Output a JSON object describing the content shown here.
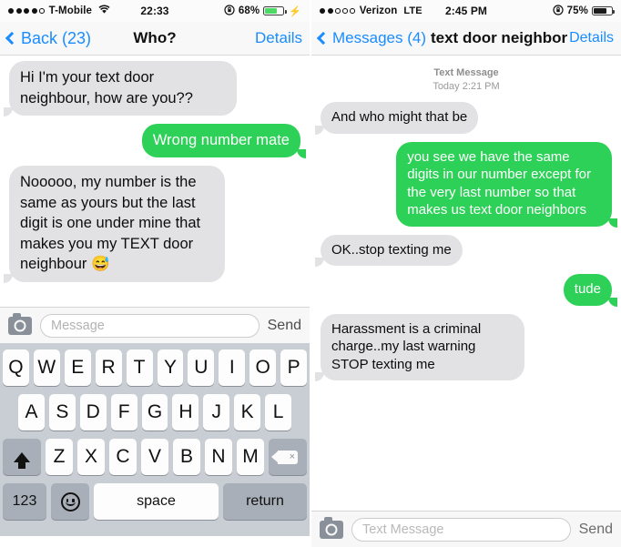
{
  "left_phone": {
    "status_bar": {
      "signal_dots_filled": 4,
      "signal_dots_total": 5,
      "carrier": "T-Mobile",
      "wifi_icon": "wifi-icon",
      "time": "22:33",
      "lock_rotation_icon": "rotation-lock-icon",
      "battery_percent": "68%",
      "battery_level": 68,
      "battery_color": "#4cd964",
      "charging_icon": "lightning-bolt-icon"
    },
    "nav_bar": {
      "back_label": "Back (23)",
      "back_icon": "chevron-left-icon",
      "title": "Who?",
      "details_label": "Details"
    },
    "messages": [
      {
        "side": "in",
        "text": "Hi I'm your text door neighbour, how are you??"
      },
      {
        "side": "out",
        "text": "Wrong number mate"
      },
      {
        "side": "in",
        "text": "Nooooo, my number is the same as yours but the last digit is one under mine that makes you my TEXT door neighbour 😅"
      }
    ],
    "composer": {
      "camera_icon": "camera-icon",
      "input_value": "",
      "input_placeholder": "Message",
      "send_label": "Send"
    },
    "keyboard": {
      "row1": [
        "Q",
        "W",
        "E",
        "R",
        "T",
        "Y",
        "U",
        "I",
        "O",
        "P"
      ],
      "row2": [
        "A",
        "S",
        "D",
        "F",
        "G",
        "H",
        "J",
        "K",
        "L"
      ],
      "row3": [
        "Z",
        "X",
        "C",
        "V",
        "B",
        "N",
        "M"
      ],
      "shift_icon": "shift-arrow-icon",
      "delete_icon": "backspace-delete-icon",
      "numbers_label": "123",
      "emoji_icon": "emoji-smiley-icon",
      "space_label": "space",
      "return_label": "return"
    }
  },
  "right_phone": {
    "status_bar": {
      "signal_dots_filled": 2,
      "signal_dots_total": 5,
      "carrier": "Verizon",
      "network": "LTE",
      "time": "2:45 PM",
      "lock_rotation_icon": "rotation-lock-icon",
      "battery_percent": "75%",
      "battery_level": 75,
      "battery_color": "#1c1c1c"
    },
    "nav_bar": {
      "back_label": "Messages (4)",
      "back_icon": "chevron-left-icon",
      "title": "text door neighbor",
      "details_label": "Details"
    },
    "timestamp": {
      "type_label": "Text Message",
      "when_label": "Today 2:21 PM"
    },
    "messages": [
      {
        "side": "in",
        "text": "And who might that be"
      },
      {
        "side": "out",
        "text": "you see we have the same digits in our number except for the very last number so that makes us text door neighbors"
      },
      {
        "side": "in",
        "text": "OK..stop texting me"
      },
      {
        "side": "out",
        "text": "tude"
      },
      {
        "side": "in",
        "text": "Harassment is a criminal charge..my last warning STOP texting me"
      }
    ],
    "composer": {
      "camera_icon": "camera-icon",
      "input_value": "",
      "input_placeholder": "Text Message",
      "send_label": "Send"
    }
  },
  "colors": {
    "outgoing_bubble": "#2ed158",
    "incoming_bubble": "#e2e2e5",
    "link_blue": "#1a8cff",
    "keyboard_bg": "#c9ced4"
  }
}
